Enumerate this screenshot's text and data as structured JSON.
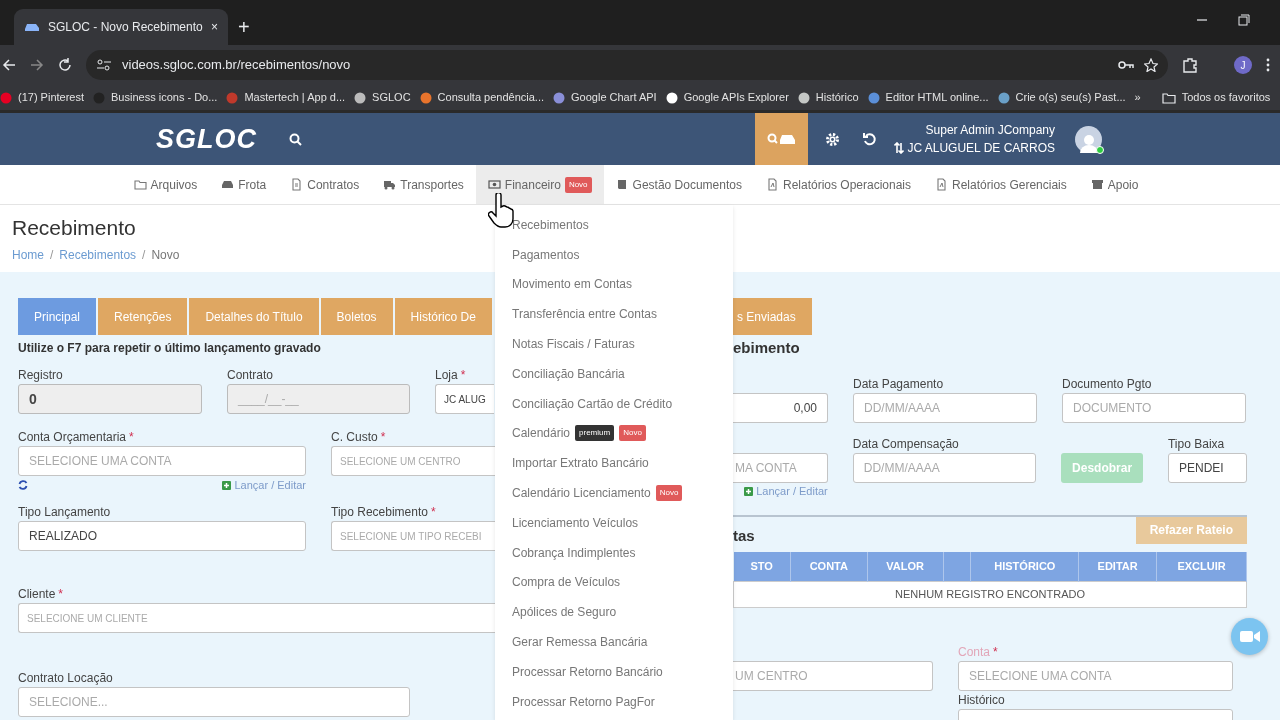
{
  "browser": {
    "tab_title": "SGLOC - Novo Recebimento",
    "tab_close": "×",
    "new_tab": "+",
    "url": "videos.sgloc.com.br/recebimentos/novo",
    "profile": "J",
    "bookmarks": [
      {
        "label": "(17) Pinterest",
        "color": "#e60023"
      },
      {
        "label": "Business icons - Do...",
        "color": "#222222"
      },
      {
        "label": "Mastertech | App d...",
        "color": "#c0392b"
      },
      {
        "label": "SGLOC",
        "color": "#bbbbbb"
      },
      {
        "label": "Consulta pendência...",
        "color": "#e8742c"
      },
      {
        "label": "Google Chart API",
        "color": "#8a8fd8"
      },
      {
        "label": "Google APIs Explorer",
        "color": "#ffffff"
      },
      {
        "label": "Histórico",
        "color": "#c4c7c5"
      },
      {
        "label": "Editor HTML online...",
        "color": "#5b8fd8"
      },
      {
        "label": "Crie o(s) seu(s) Past...",
        "color": "#6aa0c8"
      }
    ],
    "bookmarks_more": "»",
    "all_bookmarks": "Todos os favoritos"
  },
  "header": {
    "logo": "SGLOC",
    "user_name": "Super Admin JCompany",
    "company": "JC ALUGUEL DE CARROS",
    "online": true
  },
  "nav": [
    {
      "label": "Arquivos",
      "selected": false
    },
    {
      "label": "Frota",
      "selected": false
    },
    {
      "label": "Contratos",
      "selected": false
    },
    {
      "label": "Transportes",
      "selected": false
    },
    {
      "label": "Financeiro",
      "selected": true,
      "badge": "Novo"
    },
    {
      "label": "Gestão Documentos",
      "selected": false
    },
    {
      "label": "Relatórios Operacionais",
      "selected": false
    },
    {
      "label": "Relatórios Gerenciais",
      "selected": false
    },
    {
      "label": "Apoio",
      "selected": false
    }
  ],
  "menu": [
    {
      "label": "Recebimentos"
    },
    {
      "label": "Pagamentos"
    },
    {
      "label": "Movimento em Contas"
    },
    {
      "label": "Transferência entre Contas"
    },
    {
      "label": "Notas Fiscais / Faturas"
    },
    {
      "label": "Conciliação Bancária"
    },
    {
      "label": "Conciliação Cartão de Crédito"
    },
    {
      "label": "Calendário",
      "badges": [
        {
          "text": "premium",
          "kind": "dark"
        },
        {
          "text": "Novo",
          "kind": "danger"
        }
      ]
    },
    {
      "label": "Importar Extrato Bancário"
    },
    {
      "label": "Calendário Licenciamento",
      "badges": [
        {
          "text": "Novo",
          "kind": "danger"
        }
      ]
    },
    {
      "label": "Licenciamento Veículos"
    },
    {
      "label": "Cobrança Indimplentes"
    },
    {
      "label": "Compra de Veículos"
    },
    {
      "label": "Apólices de Seguro"
    },
    {
      "label": "Gerar Remessa Bancária"
    },
    {
      "label": "Processar Retorno Bancário"
    },
    {
      "label": "Processar Retorno PagFor"
    }
  ],
  "page": {
    "title": "Recebimento",
    "separator": "/",
    "breadcrumb": [
      {
        "label": "Home",
        "link": true
      },
      {
        "label": "Recebimentos",
        "link": true
      },
      {
        "label": "Novo",
        "link": false
      }
    ]
  },
  "left": {
    "tabs": [
      {
        "label": "Principal",
        "selected": true
      },
      {
        "label": "Retenções",
        "selected": false
      },
      {
        "label": "Detalhes do Título",
        "selected": false
      },
      {
        "label": "Boletos",
        "selected": false
      },
      {
        "label": "Histórico De",
        "selected": false
      }
    ],
    "hint": "Utilize o F7 para repetir o último lançamento gravado",
    "rows": [
      [
        {
          "label": "Registro",
          "kind": "input",
          "value": "0",
          "disabled": true
        },
        {
          "label": "Contrato",
          "kind": "input",
          "placeholder": "____/__-__",
          "disabled": true
        },
        {
          "label": "Loja",
          "required_mark": "*",
          "kind": "select",
          "value": "JC ALUG"
        }
      ],
      [
        {
          "label": "Conta Orçamentaria",
          "required_mark": "*",
          "kind": "select",
          "placeholder": "SELECIONE UMA CONTA",
          "refresh": true,
          "link": "Lançar / Editar"
        },
        {
          "label": "C. Custo",
          "required_mark": "*",
          "kind": "select",
          "placeholder": "SELECIONE UM CENTRO"
        }
      ],
      [
        {
          "label": "Tipo Lançamento",
          "kind": "select",
          "value": "REALIZADO"
        },
        {
          "label": "Tipo Recebimento",
          "required_mark": "*",
          "kind": "select",
          "placeholder": "SELECIONE UM TIPO RECEBI"
        }
      ],
      [
        {
          "label": "Cliente",
          "required_mark": "*",
          "kind": "select",
          "placeholder": "SELECIONE UM CLIENTE"
        }
      ],
      [
        {
          "label": "Contrato Locação",
          "kind": "select",
          "placeholder": "SELECIONE..."
        }
      ]
    ]
  },
  "right": {
    "tabs": [
      {
        "label": "s Enviadas",
        "selected": false
      }
    ],
    "heading": "ebimento",
    "rows": [
      [
        {
          "kind": "input",
          "value": "0,00"
        },
        {
          "label": "Data Pagamento",
          "kind": "input",
          "placeholder": "DD/MM/AAAA"
        },
        {
          "label": "Documento Pgto",
          "kind": "input",
          "placeholder": "DOCUMENTO"
        }
      ],
      [
        {
          "kind": "select",
          "placeholder": "MA CONTA",
          "link": "Lançar / Editar"
        },
        {
          "label": "Data Compensação",
          "kind": "input",
          "placeholder": "DD/MM/AAAA"
        },
        {
          "kind": "button",
          "value": "Desdobrar",
          "disabled": true
        },
        {
          "label": "Tipo Baixa",
          "kind": "select",
          "value": "PENDEI"
        }
      ]
    ],
    "section": {
      "heading": "tas",
      "button": "Refazer Rateio",
      "table": {
        "columns": [
          {
            "kind": "text",
            "label": "STO"
          },
          {
            "kind": "text",
            "label": "CONTA"
          },
          {
            "kind": "text",
            "label": "VALOR"
          },
          {
            "kind": "blank"
          },
          {
            "kind": "text",
            "label": "HISTÓRICO"
          },
          {
            "kind": "text",
            "label": "EDITAR"
          },
          {
            "kind": "text",
            "label": "EXCLUIR"
          }
        ],
        "empty": "NENHUM REGISTRO ENCONTRADO"
      }
    },
    "rows2": [
      [
        {
          "kind": "select",
          "placeholder": "UM CENTRO"
        },
        {
          "label": "Conta",
          "required_mark": "*",
          "dimmed": true,
          "kind": "select",
          "placeholder": "SELECIONE UMA CONTA"
        }
      ],
      [
        {
          "kind": "none"
        },
        {
          "label": "Histórico",
          "kind": "input"
        }
      ]
    ]
  }
}
